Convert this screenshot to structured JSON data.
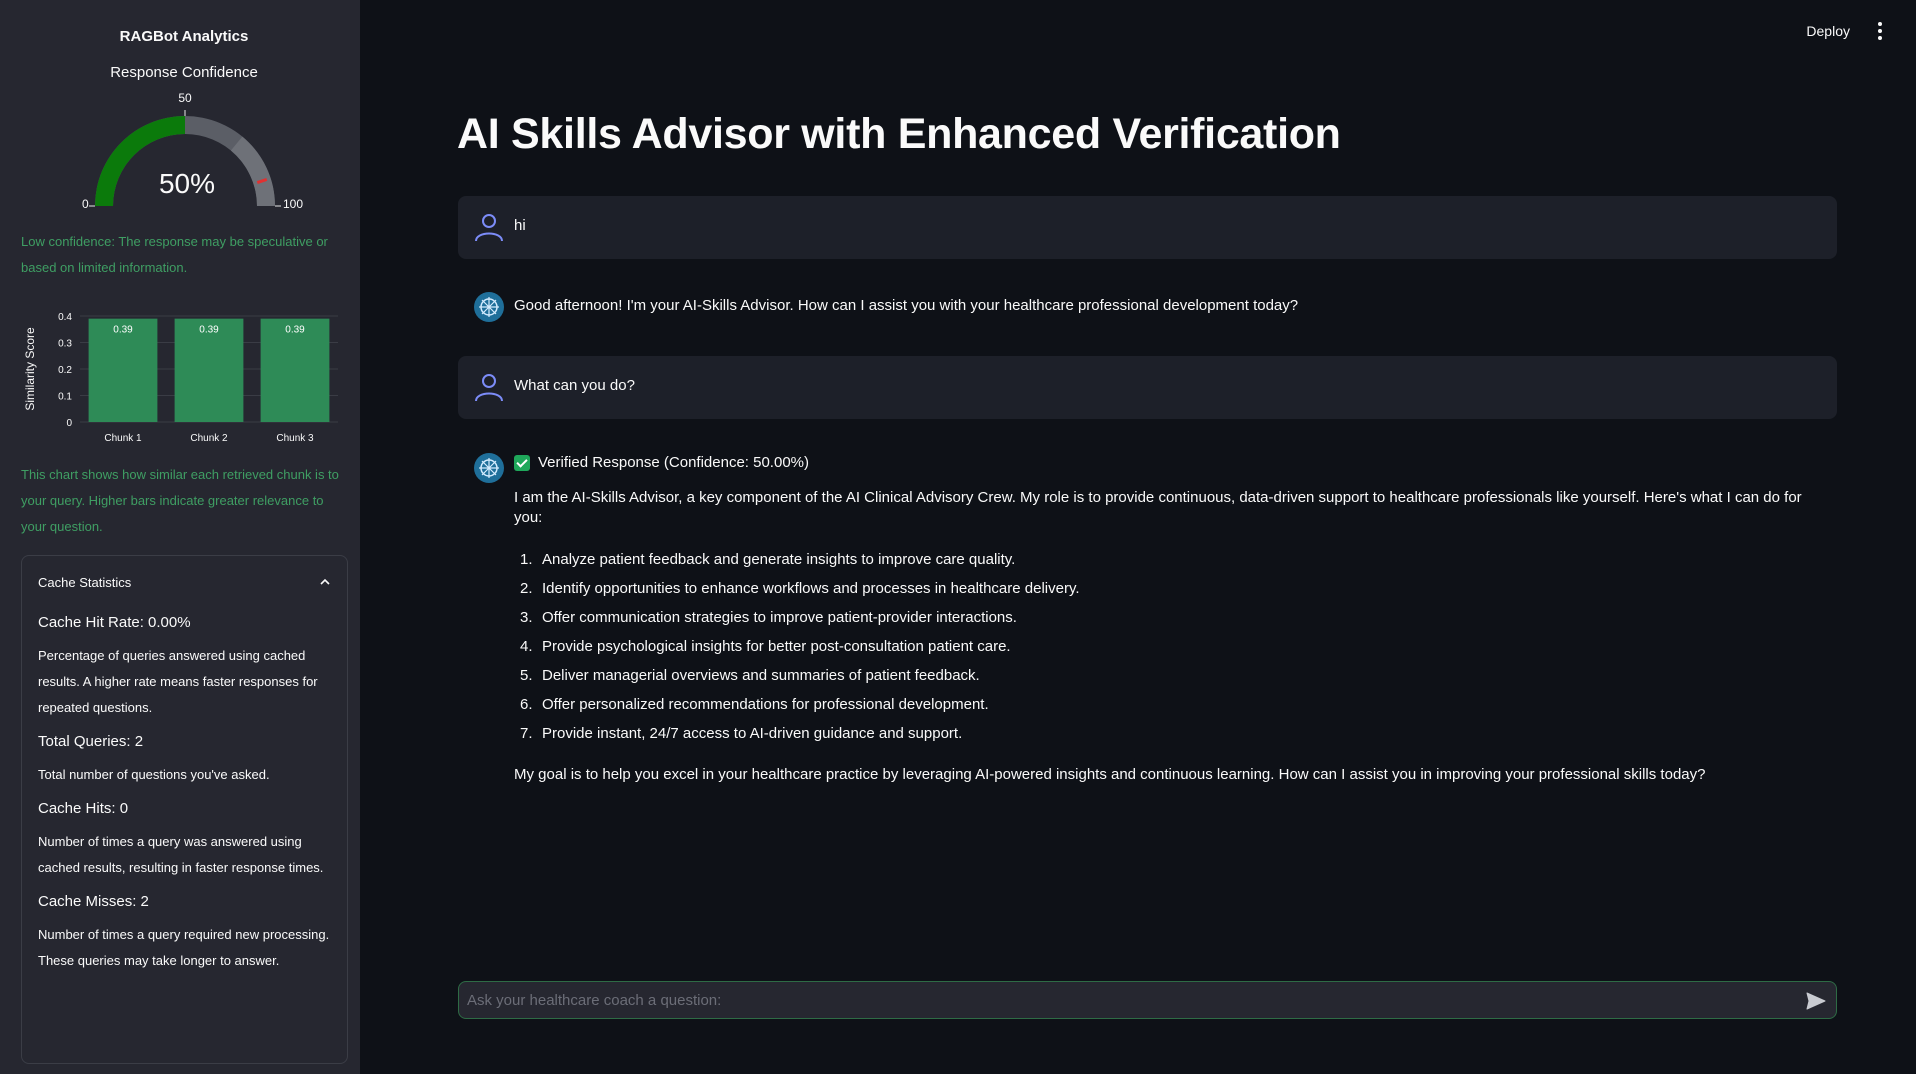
{
  "sidebar": {
    "title": "RAGBot Analytics",
    "gauge": {
      "title": "Response Confidence",
      "value": 50,
      "value_label": "50%",
      "min_label": "0",
      "mid_label": "50",
      "max_label": "100",
      "fill_color": "#0b7a0b"
    },
    "confidence_note": "Low confidence: The response may be speculative or based on limited information.",
    "chart_note": "This chart shows how similar each retrieved chunk is to your query. Higher bars indicate greater relevance to your question.",
    "cache": {
      "header": "Cache Statistics",
      "hit_rate": "Cache Hit Rate: 0.00%",
      "hit_rate_desc": "Percentage of queries answered using cached results. A higher rate means faster responses for repeated questions.",
      "total_queries": "Total Queries: 2",
      "total_queries_desc": "Total number of questions you've asked.",
      "hits": "Cache Hits: 0",
      "hits_desc": "Number of times a query was answered using cached results, resulting in faster response times.",
      "misses": "Cache Misses: 2",
      "misses_desc": "Number of times a query required new processing. These queries may take longer to answer."
    }
  },
  "chart_data": [
    {
      "type": "gauge",
      "title": "Response Confidence",
      "value": 50,
      "range": [
        0,
        100
      ]
    },
    {
      "type": "bar",
      "categories": [
        "Chunk 1",
        "Chunk 2",
        "Chunk 3"
      ],
      "values": [
        0.39,
        0.39,
        0.39
      ],
      "data_labels": [
        "0.39",
        "0.39",
        "0.39"
      ],
      "ylabel": "Similarity Score",
      "ylim": [
        0,
        0.4
      ],
      "yticks": [
        "0",
        "0.1",
        "0.2",
        "0.3",
        "0.4"
      ],
      "bar_color": "#2e8b57"
    }
  ],
  "topbar": {
    "deploy_label": "Deploy"
  },
  "main": {
    "title": "AI Skills Advisor with Enhanced Verification",
    "messages": [
      {
        "role": "user",
        "text": "hi"
      },
      {
        "role": "assistant",
        "text": "Good afternoon! I'm your AI-Skills Advisor. How can I assist you with your healthcare professional development today?"
      },
      {
        "role": "user",
        "text": "What can you do?"
      }
    ],
    "response": {
      "verified_label": "Verified Response (Confidence: 50.00%)",
      "intro": "I am the AI-Skills Advisor, a key component of the AI Clinical Advisory Crew. My role is to provide continuous, data-driven support to healthcare professionals like yourself. Here's what I can do for you:",
      "items": [
        {
          "num": "1.",
          "text": "Analyze patient feedback and generate insights to improve care quality."
        },
        {
          "num": "2.",
          "text": "Identify opportunities to enhance workflows and processes in healthcare delivery."
        },
        {
          "num": "3.",
          "text": "Offer communication strategies to improve patient-provider interactions."
        },
        {
          "num": "4.",
          "text": "Provide psychological insights for better post-consultation patient care."
        },
        {
          "num": "5.",
          "text": "Deliver managerial overviews and summaries of patient feedback."
        },
        {
          "num": "6.",
          "text": "Offer personalized recommendations for professional development."
        },
        {
          "num": "7.",
          "text": "Provide instant, 24/7 access to AI-driven guidance and support."
        }
      ],
      "closing": "My goal is to help you excel in your healthcare practice by leveraging AI-powered insights and continuous learning. How can I assist you in improving your professional skills today?"
    },
    "input": {
      "placeholder": "Ask your healthcare coach a question:",
      "value": ""
    }
  }
}
